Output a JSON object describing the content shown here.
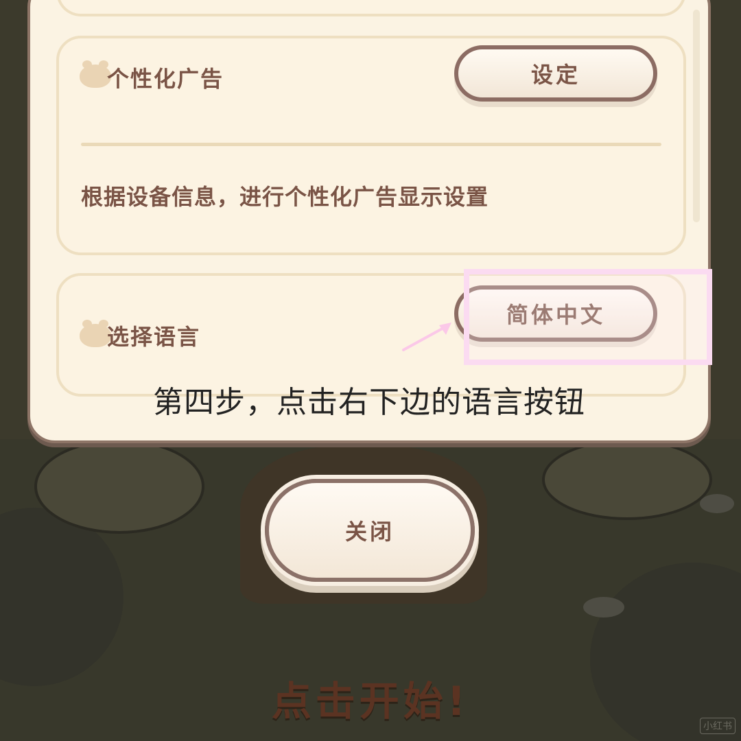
{
  "settings": {
    "personalized_ads": {
      "title": "个性化广告",
      "button_label": "设定",
      "description": "根据设备信息，进行个性化广告显示设置"
    },
    "language": {
      "title": "选择语言",
      "button_label": "简体中文"
    }
  },
  "tutorial": {
    "caption": "第四步，点击右下边的语言按钮"
  },
  "dialog": {
    "close_label": "关闭"
  },
  "background": {
    "start_text": "点击开始!",
    "watermark": "小红书"
  },
  "colors": {
    "panel": "#fbf3e3",
    "text_brown": "#7a5446",
    "highlight_pink": "#fbdbf1",
    "button_border": "#8c6c63"
  }
}
